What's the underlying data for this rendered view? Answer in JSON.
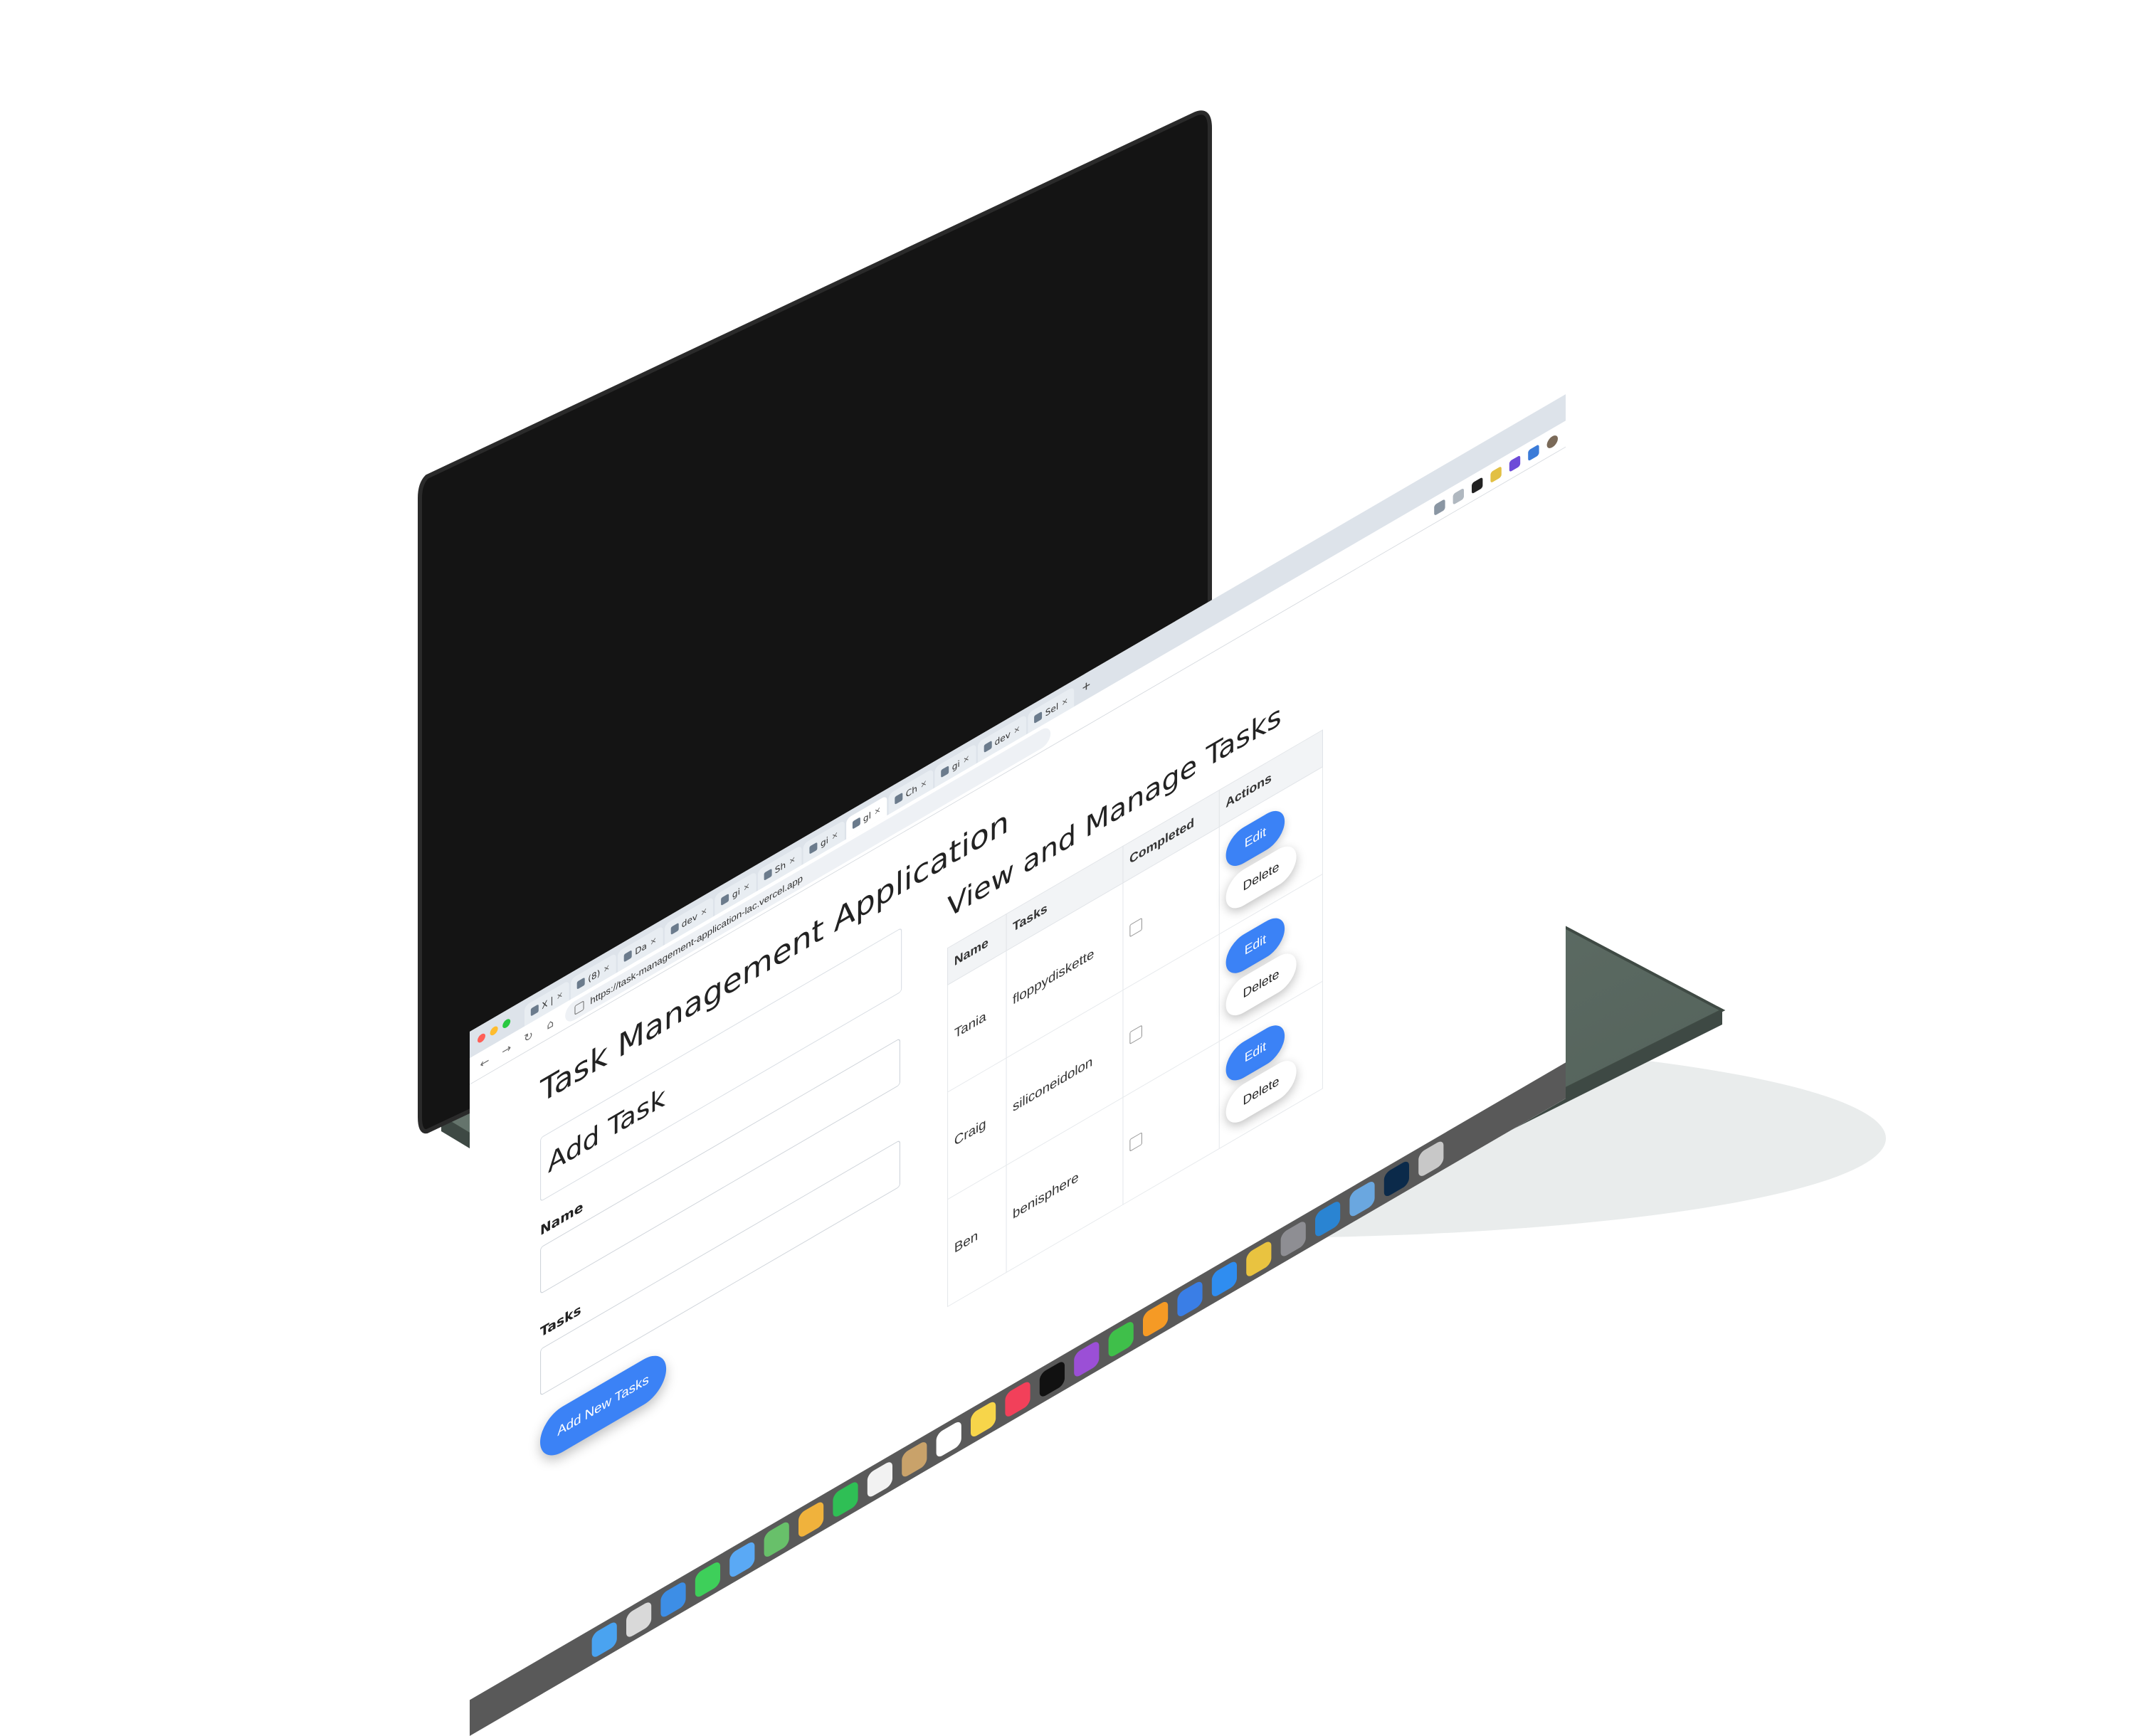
{
  "browser": {
    "tabs": [
      {
        "label": "X |",
        "active": false
      },
      {
        "label": "(8)",
        "active": false
      },
      {
        "label": "Da",
        "active": false
      },
      {
        "label": "dev",
        "active": false
      },
      {
        "label": "gi",
        "active": false
      },
      {
        "label": "Sh",
        "active": false
      },
      {
        "label": "gi",
        "active": false
      },
      {
        "label": "gl",
        "active": true
      },
      {
        "label": "Ch",
        "active": false
      },
      {
        "label": "gi",
        "active": false
      },
      {
        "label": "dev",
        "active": false
      },
      {
        "label": "Sel",
        "active": false
      }
    ],
    "new_tab_symbol": "+",
    "url": "https://task-management-application-lac.vercel.app",
    "nav": {
      "back": "←",
      "forward": "→",
      "reload": "↻",
      "home": "⌂"
    }
  },
  "app": {
    "title": "Task Management Application",
    "add_section": {
      "title": "Add Task",
      "name_label": "Name",
      "tasks_label": "Tasks",
      "submit_label": "Add New Tasks"
    },
    "manage_section": {
      "title": "View and Manage Tasks",
      "columns": [
        "Name",
        "Tasks",
        "Completed",
        "Actions"
      ],
      "rows": [
        {
          "name": "Tania",
          "task": "floppydiskette",
          "completed": false
        },
        {
          "name": "Craig",
          "task": "siliconeidolon",
          "completed": false
        },
        {
          "name": "Ben",
          "task": "benisphere",
          "completed": false
        }
      ],
      "edit_label": "Edit",
      "delete_label": "Delete"
    }
  },
  "colors": {
    "accent": "#3b82f6",
    "laptop_body": "#5f6f66",
    "bezel": "#141414"
  }
}
